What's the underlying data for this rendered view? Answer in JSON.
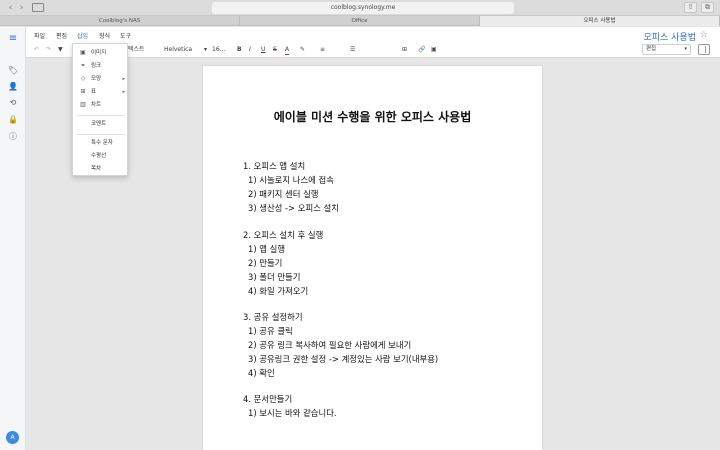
{
  "browser": {
    "url": "coolblog.synology.me",
    "back_icon": "‹",
    "forward_icon": "›",
    "share_icon": "⇧",
    "tabs_icon": "⧉",
    "tabs": [
      {
        "label": "Coolblog's NAS"
      },
      {
        "label": "Office"
      },
      {
        "label": "오피스 사용법"
      }
    ]
  },
  "rail": {
    "menu_icon": "≡",
    "icons": [
      "🏷",
      "👤",
      "⟲",
      "🔒",
      "ⓘ"
    ],
    "avatar": "A"
  },
  "menu": {
    "items": [
      "파일",
      "편집",
      "삽입",
      "형식",
      "도구"
    ],
    "active": "삽입"
  },
  "header": {
    "doc_title": "오피스 사용법",
    "star": "☆"
  },
  "toolbar": {
    "undo": "↶",
    "redo": "↷",
    "paint": "▼",
    "style": "텍스트",
    "font": "Helvetica",
    "size": "16...",
    "bold": "B",
    "italic": "I",
    "underline": "U",
    "strike": "S",
    "text_color": "A",
    "highlight": "✎",
    "align": "≡",
    "list": "☰",
    "table": "⊞",
    "link": "🔗",
    "comment": "▣",
    "mode": "편집",
    "caret": "▾"
  },
  "dropdown": {
    "items": [
      {
        "icon": "▣",
        "label": "이미지"
      },
      {
        "icon": "⚭",
        "label": "링크"
      },
      {
        "icon": "◇",
        "label": "모양",
        "arrow": "▸"
      },
      {
        "icon": "⊞",
        "label": "표",
        "arrow": "▸"
      },
      {
        "icon": "▥",
        "label": "차트"
      },
      {
        "label": "코멘트"
      },
      {
        "label": "특수 문자"
      },
      {
        "label": "수평선"
      },
      {
        "label": "목차"
      }
    ]
  },
  "document": {
    "heading": "에이블 미션 수행을 위한 오피스 사용법",
    "lines": [
      "1. 오피스 앱 설치",
      "1) 시놀로지 나스에 접속",
      "2) 패키지 센터 실행",
      "3) 생산성 -> 오피스 설치",
      "2. 오피스 설치 후 실행",
      "1) 앱 실행",
      "2) 만들기",
      "3) 폴더 만들기",
      "4) 화일 가져오기",
      "3. 공유 설정하기",
      "1) 공유 클릭",
      "2) 공유 링크 복사하여 필요한 사람에게 보내기",
      "3) 공유링크 권한 설정 -> 계정있는 사람 보기(내부용)",
      "4) 확인",
      "4. 문서만들기",
      "1) 보시는 바와 같습니다."
    ]
  }
}
